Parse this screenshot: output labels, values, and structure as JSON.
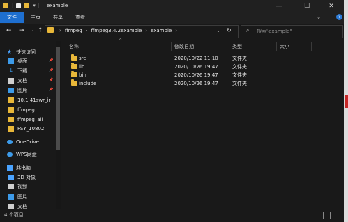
{
  "window": {
    "title": "example"
  },
  "ribbon": {
    "tabs": [
      "文件",
      "主页",
      "共享",
      "查看"
    ]
  },
  "address": {
    "crumbs": [
      "ffmpeg",
      "ffmpeg3.4.2example",
      "example"
    ],
    "search_placeholder": "搜索\"example\""
  },
  "nav": {
    "items": [
      {
        "label": "快速访问",
        "icon": "star-icon",
        "color": "#4aa3ff"
      },
      {
        "label": "桌面",
        "icon": "desktop-icon",
        "color": "#3d9be9"
      },
      {
        "label": "下载",
        "icon": "download-icon",
        "color": "#3d9be9"
      },
      {
        "label": "文档",
        "icon": "document-icon",
        "color": "#cfcfcf"
      },
      {
        "label": "图片",
        "icon": "picture-icon",
        "color": "#3d9be9"
      },
      {
        "label": "10.1 41swr_ir",
        "icon": "folder-icon",
        "color": "#e8b739"
      },
      {
        "label": "ffmpeg",
        "icon": "folder-icon",
        "color": "#e8b739"
      },
      {
        "label": "ffmpeg_all",
        "icon": "folder-icon",
        "color": "#e8b739"
      },
      {
        "label": "FSY_10802",
        "icon": "folder-icon",
        "color": "#e8b739"
      },
      {
        "label": "OneDrive",
        "icon": "cloud-icon",
        "color": "#3d9be9"
      },
      {
        "label": "WPS网盘",
        "icon": "cloud-icon",
        "color": "#3d9be9"
      },
      {
        "label": "此电脑",
        "icon": "computer-icon",
        "color": "#4aa3ff"
      },
      {
        "label": "3D 对象",
        "icon": "cube-icon",
        "color": "#4aa3ff"
      },
      {
        "label": "视频",
        "icon": "video-icon",
        "color": "#cfcfcf"
      },
      {
        "label": "图片",
        "icon": "picture-icon",
        "color": "#3d9be9"
      },
      {
        "label": "文档",
        "icon": "document-icon",
        "color": "#cfcfcf"
      }
    ]
  },
  "columns": {
    "name": "名称",
    "modified": "修改日期",
    "type": "类型",
    "size": "大小"
  },
  "files": [
    {
      "name": "src",
      "modified": "2020/10/22 11:10",
      "type": "文件夹"
    },
    {
      "name": "lib",
      "modified": "2020/10/26 19:47",
      "type": "文件夹"
    },
    {
      "name": "bin",
      "modified": "2020/10/26 19:47",
      "type": "文件夹"
    },
    {
      "name": "include",
      "modified": "2020/10/26 19:47",
      "type": "文件夹"
    }
  ],
  "status": {
    "count": "4 个项目"
  },
  "colors": {
    "accent": "#1e6fd0",
    "folder": "#e8b739",
    "background": "#191919"
  }
}
